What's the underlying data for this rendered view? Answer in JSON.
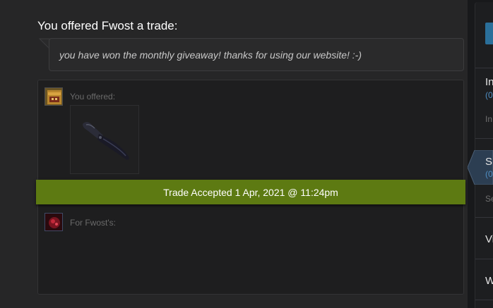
{
  "trade": {
    "heading": "You offered Fwost a trade:",
    "message": "you have won the monthly giveaway! thanks for using our website! :-)",
    "you_offered_label": "You offered:",
    "for_them_label": "For Fwost's:",
    "status": "Trade Accepted 1 Apr, 2021 @ 11:24pm"
  },
  "colors": {
    "status_green": "#5d7a12",
    "link_blue": "#4f8ec3",
    "accent_blue": "#2a6f9a"
  },
  "sidebar": {
    "item1": {
      "letter": "In",
      "count": "(0",
      "sub": "In"
    },
    "item2": {
      "letter": "S",
      "count": "(0",
      "sub": "Se"
    },
    "item3": {
      "letter": "Vi"
    },
    "item4": {
      "letter": "W"
    }
  },
  "item": {
    "icon": "folding-knife-icon"
  }
}
